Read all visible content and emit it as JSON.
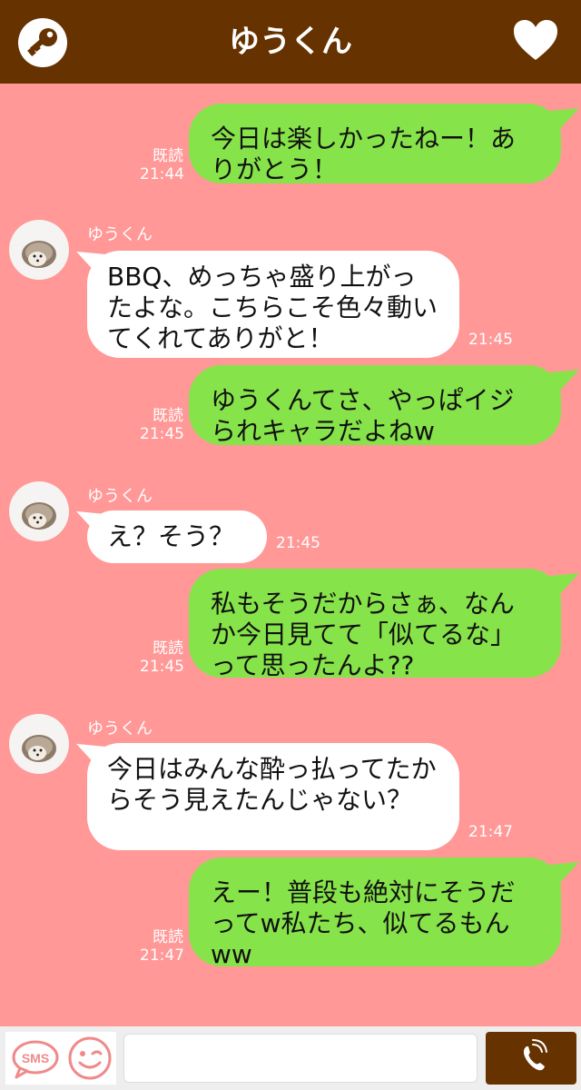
{
  "header": {
    "title": "ゆうくん",
    "key_icon": "key-icon",
    "heart_icon": "heart-icon"
  },
  "messages": [
    {
      "type": "sent",
      "text": "今日は楽しかったねー！ありがとう！",
      "read": "既読",
      "time": "21:44"
    },
    {
      "type": "received",
      "sender": "ゆうくん",
      "text": "BBQ、めっちゃ盛り上がったよな。こちらこそ色々動いてくれてありがと！",
      "time": "21:45"
    },
    {
      "type": "sent",
      "text": "ゆうくんてさ、やっぱイジられキャラだよねw",
      "read": "既読",
      "time": "21:45"
    },
    {
      "type": "received",
      "sender": "ゆうくん",
      "text": "え？そう？",
      "time": "21:45"
    },
    {
      "type": "sent",
      "text": "私もそうだからさぁ、なんか今日見てて「似てるな」って思ったんよ??",
      "read": "既読",
      "time": "21:45"
    },
    {
      "type": "received",
      "sender": "ゆうくん",
      "text": "今日はみんな酔っ払ってたからそう見えたんじゃない？",
      "time": "21:47"
    },
    {
      "type": "sent",
      "text": "えー！普段も絶対にそうだってw私たち、似てるもんww",
      "read": "既読",
      "time": "21:47"
    }
  ],
  "bottom_bar": {
    "sms_label": "SMS",
    "input_value": "",
    "icons": [
      "sms-icon",
      "smile-icon",
      "phone-icon"
    ]
  },
  "colors": {
    "header": "#663300",
    "background": "#ff9896",
    "sent_bubble": "#87e34a",
    "received_bubble": "#ffffff"
  }
}
